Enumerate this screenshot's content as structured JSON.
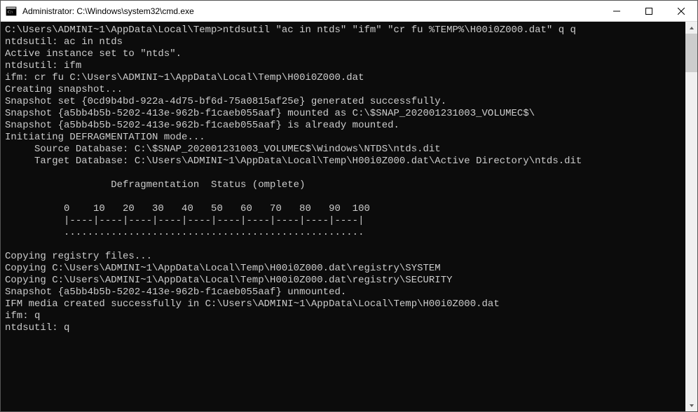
{
  "window": {
    "title": "Administrator: C:\\Windows\\system32\\cmd.exe"
  },
  "terminal": {
    "lines": [
      "C:\\Users\\ADMINI~1\\AppData\\Local\\Temp>ntdsutil \"ac in ntds\" \"ifm\" \"cr fu %TEMP%\\H00i0Z000.dat\" q q",
      "ntdsutil: ac in ntds",
      "Active instance set to \"ntds\".",
      "ntdsutil: ifm",
      "ifm: cr fu C:\\Users\\ADMINI~1\\AppData\\Local\\Temp\\H00i0Z000.dat",
      "Creating snapshot...",
      "Snapshot set {0cd9b4bd-922a-4d75-bf6d-75a0815af25e} generated successfully.",
      "Snapshot {a5bb4b5b-5202-413e-962b-f1caeb055aaf} mounted as C:\\$SNAP_202001231003_VOLUMEC$\\",
      "Snapshot {a5bb4b5b-5202-413e-962b-f1caeb055aaf} is already mounted.",
      "Initiating DEFRAGMENTATION mode...",
      "     Source Database: C:\\$SNAP_202001231003_VOLUMEC$\\Windows\\NTDS\\ntds.dit",
      "     Target Database: C:\\Users\\ADMINI~1\\AppData\\Local\\Temp\\H00i0Z000.dat\\Active Directory\\ntds.dit",
      "",
      "                  Defragmentation  Status (omplete)",
      "",
      "          0    10   20   30   40   50   60   70   80   90  100",
      "          |----|----|----|----|----|----|----|----|----|----|",
      "          ...................................................",
      "",
      "Copying registry files...",
      "Copying C:\\Users\\ADMINI~1\\AppData\\Local\\Temp\\H00i0Z000.dat\\registry\\SYSTEM",
      "Copying C:\\Users\\ADMINI~1\\AppData\\Local\\Temp\\H00i0Z000.dat\\registry\\SECURITY",
      "Snapshot {a5bb4b5b-5202-413e-962b-f1caeb055aaf} unmounted.",
      "IFM media created successfully in C:\\Users\\ADMINI~1\\AppData\\Local\\Temp\\H00i0Z000.dat",
      "ifm: q",
      "ntdsutil: q"
    ]
  }
}
